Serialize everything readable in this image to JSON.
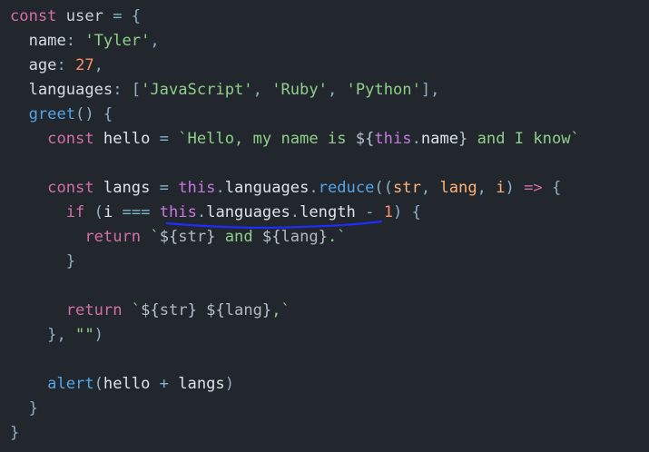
{
  "editor": {
    "background": "#22272e",
    "annotation_color": "#1e2cff",
    "lines": [
      [
        {
          "t": "const",
          "c": "keyword"
        },
        {
          "t": " user ",
          "c": "plain"
        },
        {
          "t": "=",
          "c": "operator"
        },
        {
          "t": " {",
          "c": "punct"
        }
      ],
      [
        {
          "t": "  name",
          "c": "property"
        },
        {
          "t": ": ",
          "c": "punct"
        },
        {
          "t": "'Tyler'",
          "c": "string"
        },
        {
          "t": ",",
          "c": "punct"
        }
      ],
      [
        {
          "t": "  age",
          "c": "property"
        },
        {
          "t": ": ",
          "c": "punct"
        },
        {
          "t": "27",
          "c": "number"
        },
        {
          "t": ",",
          "c": "punct"
        }
      ],
      [
        {
          "t": "  languages",
          "c": "property"
        },
        {
          "t": ": [",
          "c": "punct"
        },
        {
          "t": "'JavaScript'",
          "c": "string"
        },
        {
          "t": ", ",
          "c": "punct"
        },
        {
          "t": "'Ruby'",
          "c": "string"
        },
        {
          "t": ", ",
          "c": "punct"
        },
        {
          "t": "'Python'",
          "c": "string"
        },
        {
          "t": "],",
          "c": "punct"
        }
      ],
      [
        {
          "t": "  greet",
          "c": "function"
        },
        {
          "t": "() {",
          "c": "punct"
        }
      ],
      [
        {
          "t": "    const",
          "c": "keyword"
        },
        {
          "t": " hello ",
          "c": "var"
        },
        {
          "t": "=",
          "c": "operator"
        },
        {
          "t": " `Hello, my name is ",
          "c": "string"
        },
        {
          "t": "${",
          "c": "template-punct"
        },
        {
          "t": "this",
          "c": "this"
        },
        {
          "t": ".",
          "c": "punct"
        },
        {
          "t": "name",
          "c": "var"
        },
        {
          "t": "}",
          "c": "template-punct"
        },
        {
          "t": " and I know`",
          "c": "string"
        }
      ],
      [
        {
          "t": "",
          "c": "plain"
        }
      ],
      [
        {
          "t": "    const",
          "c": "keyword"
        },
        {
          "t": " langs ",
          "c": "var"
        },
        {
          "t": "=",
          "c": "operator"
        },
        {
          "t": " ",
          "c": "plain"
        },
        {
          "t": "this",
          "c": "this"
        },
        {
          "t": ".",
          "c": "punct"
        },
        {
          "t": "languages",
          "c": "var"
        },
        {
          "t": ".",
          "c": "punct"
        },
        {
          "t": "reduce",
          "c": "function"
        },
        {
          "t": "((",
          "c": "punct"
        },
        {
          "t": "str",
          "c": "param"
        },
        {
          "t": ", ",
          "c": "punct"
        },
        {
          "t": "lang",
          "c": "param"
        },
        {
          "t": ", ",
          "c": "punct"
        },
        {
          "t": "i",
          "c": "param"
        },
        {
          "t": ") ",
          "c": "punct"
        },
        {
          "t": "=>",
          "c": "keyword"
        },
        {
          "t": " {",
          "c": "punct"
        }
      ],
      [
        {
          "t": "      if",
          "c": "keyword"
        },
        {
          "t": " (",
          "c": "punct"
        },
        {
          "t": "i",
          "c": "var"
        },
        {
          "t": " === ",
          "c": "operator"
        },
        {
          "t": "this",
          "c": "this"
        },
        {
          "t": ".",
          "c": "punct"
        },
        {
          "t": "languages",
          "c": "var"
        },
        {
          "t": ".",
          "c": "punct"
        },
        {
          "t": "length",
          "c": "var"
        },
        {
          "t": " - ",
          "c": "operator"
        },
        {
          "t": "1",
          "c": "number"
        },
        {
          "t": ") {",
          "c": "punct"
        }
      ],
      [
        {
          "t": "        return",
          "c": "keyword"
        },
        {
          "t": " `",
          "c": "string"
        },
        {
          "t": "${",
          "c": "template-punct"
        },
        {
          "t": "str",
          "c": "template-expr"
        },
        {
          "t": "}",
          "c": "template-punct"
        },
        {
          "t": " and ",
          "c": "string"
        },
        {
          "t": "${",
          "c": "template-punct"
        },
        {
          "t": "lang",
          "c": "template-expr"
        },
        {
          "t": "}",
          "c": "template-punct"
        },
        {
          "t": ".`",
          "c": "string"
        }
      ],
      [
        {
          "t": "      }",
          "c": "punct"
        }
      ],
      [
        {
          "t": "",
          "c": "plain"
        }
      ],
      [
        {
          "t": "      return",
          "c": "keyword"
        },
        {
          "t": " `",
          "c": "string"
        },
        {
          "t": "${",
          "c": "template-punct"
        },
        {
          "t": "str",
          "c": "template-expr"
        },
        {
          "t": "}",
          "c": "template-punct"
        },
        {
          "t": " ",
          "c": "string"
        },
        {
          "t": "${",
          "c": "template-punct"
        },
        {
          "t": "lang",
          "c": "template-expr"
        },
        {
          "t": "}",
          "c": "template-punct"
        },
        {
          "t": ",`",
          "c": "string"
        }
      ],
      [
        {
          "t": "    }, ",
          "c": "punct"
        },
        {
          "t": "\"\"",
          "c": "string"
        },
        {
          "t": ")",
          "c": "punct"
        }
      ],
      [
        {
          "t": "",
          "c": "plain"
        }
      ],
      [
        {
          "t": "    alert",
          "c": "function"
        },
        {
          "t": "(",
          "c": "punct"
        },
        {
          "t": "hello",
          "c": "var"
        },
        {
          "t": " + ",
          "c": "operator"
        },
        {
          "t": "langs",
          "c": "var"
        },
        {
          "t": ")",
          "c": "punct"
        }
      ],
      [
        {
          "t": "  }",
          "c": "punct"
        }
      ],
      [
        {
          "t": "}",
          "c": "punct"
        }
      ]
    ]
  }
}
